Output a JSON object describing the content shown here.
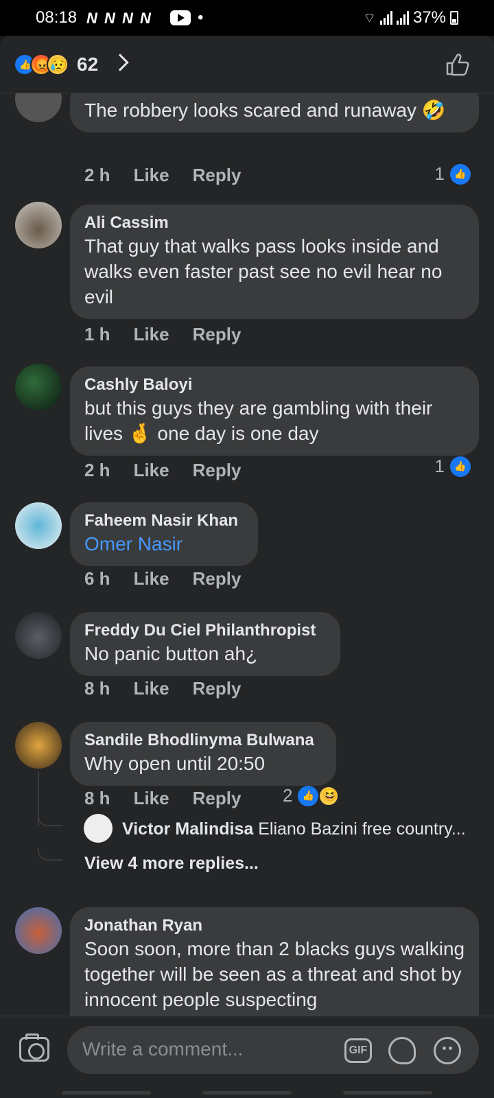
{
  "status": {
    "time": "08:18",
    "notif_icons": "N N N N",
    "dot": "•",
    "battery": "37%"
  },
  "header": {
    "reaction_count": "62",
    "reactions": [
      "like-icon",
      "angry-icon",
      "sad-icon"
    ]
  },
  "comments": [
    {
      "name": "",
      "text": "The robbery looks scared and runaway 🤣",
      "time": "2 h",
      "like": "Like",
      "reply": "Reply",
      "likes": "1"
    },
    {
      "name": "Ali Cassim",
      "text": "That guy that walks pass looks inside and walks even faster past see no evil hear no evil",
      "time": "1 h",
      "like": "Like",
      "reply": "Reply",
      "likes": ""
    },
    {
      "name": "Cashly Baloyi",
      "text": "but this guys they are gambling with their lives 🤞 one day is one day",
      "time": "2 h",
      "like": "Like",
      "reply": "Reply",
      "likes": "1"
    },
    {
      "name": "Faheem Nasir Khan",
      "text": "Omer Nasir",
      "time": "6 h",
      "like": "Like",
      "reply": "Reply",
      "likes": ""
    },
    {
      "name": "Freddy Du Ciel Philanthropist",
      "text": "No panic button ah¿",
      "time": "8 h",
      "like": "Like",
      "reply": "Reply",
      "likes": ""
    },
    {
      "name": "Sandile Bhodlinyma Bulwana",
      "text": "Why open until 20:50",
      "time": "8 h",
      "like": "Like",
      "reply": "Reply",
      "likes": "2"
    },
    {
      "name": "Jonathan Ryan",
      "text": "Soon soon, more than 2 blacks guys walking together will be seen as a threat and shot by innocent people suspecting",
      "time": "",
      "like": "",
      "reply": "",
      "likes": ""
    }
  ],
  "reply_preview": {
    "name": "Victor Malindisa",
    "text": "Eliano Bazini free country...",
    "view_more": "View 4 more replies..."
  },
  "composer": {
    "placeholder": "Write a comment...",
    "gif": "GIF"
  },
  "colors": {
    "background": "#242526",
    "bubble": "#3a3b3c",
    "accent": "#1877f2",
    "mention": "#4599ff"
  }
}
